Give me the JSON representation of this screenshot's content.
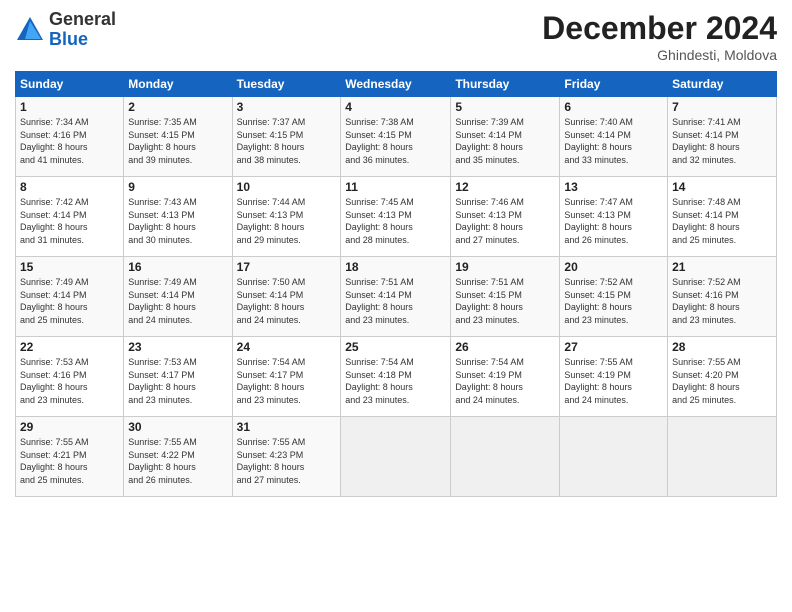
{
  "logo": {
    "general": "General",
    "blue": "Blue"
  },
  "title": "December 2024",
  "subtitle": "Ghindesti, Moldova",
  "days_of_week": [
    "Sunday",
    "Monday",
    "Tuesday",
    "Wednesday",
    "Thursday",
    "Friday",
    "Saturday"
  ],
  "weeks": [
    [
      {
        "day": "1",
        "info": "Sunrise: 7:34 AM\nSunset: 4:16 PM\nDaylight: 8 hours\nand 41 minutes."
      },
      {
        "day": "2",
        "info": "Sunrise: 7:35 AM\nSunset: 4:15 PM\nDaylight: 8 hours\nand 39 minutes."
      },
      {
        "day": "3",
        "info": "Sunrise: 7:37 AM\nSunset: 4:15 PM\nDaylight: 8 hours\nand 38 minutes."
      },
      {
        "day": "4",
        "info": "Sunrise: 7:38 AM\nSunset: 4:15 PM\nDaylight: 8 hours\nand 36 minutes."
      },
      {
        "day": "5",
        "info": "Sunrise: 7:39 AM\nSunset: 4:14 PM\nDaylight: 8 hours\nand 35 minutes."
      },
      {
        "day": "6",
        "info": "Sunrise: 7:40 AM\nSunset: 4:14 PM\nDaylight: 8 hours\nand 33 minutes."
      },
      {
        "day": "7",
        "info": "Sunrise: 7:41 AM\nSunset: 4:14 PM\nDaylight: 8 hours\nand 32 minutes."
      }
    ],
    [
      {
        "day": "8",
        "info": "Sunrise: 7:42 AM\nSunset: 4:14 PM\nDaylight: 8 hours\nand 31 minutes."
      },
      {
        "day": "9",
        "info": "Sunrise: 7:43 AM\nSunset: 4:13 PM\nDaylight: 8 hours\nand 30 minutes."
      },
      {
        "day": "10",
        "info": "Sunrise: 7:44 AM\nSunset: 4:13 PM\nDaylight: 8 hours\nand 29 minutes."
      },
      {
        "day": "11",
        "info": "Sunrise: 7:45 AM\nSunset: 4:13 PM\nDaylight: 8 hours\nand 28 minutes."
      },
      {
        "day": "12",
        "info": "Sunrise: 7:46 AM\nSunset: 4:13 PM\nDaylight: 8 hours\nand 27 minutes."
      },
      {
        "day": "13",
        "info": "Sunrise: 7:47 AM\nSunset: 4:13 PM\nDaylight: 8 hours\nand 26 minutes."
      },
      {
        "day": "14",
        "info": "Sunrise: 7:48 AM\nSunset: 4:14 PM\nDaylight: 8 hours\nand 25 minutes."
      }
    ],
    [
      {
        "day": "15",
        "info": "Sunrise: 7:49 AM\nSunset: 4:14 PM\nDaylight: 8 hours\nand 25 minutes."
      },
      {
        "day": "16",
        "info": "Sunrise: 7:49 AM\nSunset: 4:14 PM\nDaylight: 8 hours\nand 24 minutes."
      },
      {
        "day": "17",
        "info": "Sunrise: 7:50 AM\nSunset: 4:14 PM\nDaylight: 8 hours\nand 24 minutes."
      },
      {
        "day": "18",
        "info": "Sunrise: 7:51 AM\nSunset: 4:14 PM\nDaylight: 8 hours\nand 23 minutes."
      },
      {
        "day": "19",
        "info": "Sunrise: 7:51 AM\nSunset: 4:15 PM\nDaylight: 8 hours\nand 23 minutes."
      },
      {
        "day": "20",
        "info": "Sunrise: 7:52 AM\nSunset: 4:15 PM\nDaylight: 8 hours\nand 23 minutes."
      },
      {
        "day": "21",
        "info": "Sunrise: 7:52 AM\nSunset: 4:16 PM\nDaylight: 8 hours\nand 23 minutes."
      }
    ],
    [
      {
        "day": "22",
        "info": "Sunrise: 7:53 AM\nSunset: 4:16 PM\nDaylight: 8 hours\nand 23 minutes."
      },
      {
        "day": "23",
        "info": "Sunrise: 7:53 AM\nSunset: 4:17 PM\nDaylight: 8 hours\nand 23 minutes."
      },
      {
        "day": "24",
        "info": "Sunrise: 7:54 AM\nSunset: 4:17 PM\nDaylight: 8 hours\nand 23 minutes."
      },
      {
        "day": "25",
        "info": "Sunrise: 7:54 AM\nSunset: 4:18 PM\nDaylight: 8 hours\nand 23 minutes."
      },
      {
        "day": "26",
        "info": "Sunrise: 7:54 AM\nSunset: 4:19 PM\nDaylight: 8 hours\nand 24 minutes."
      },
      {
        "day": "27",
        "info": "Sunrise: 7:55 AM\nSunset: 4:19 PM\nDaylight: 8 hours\nand 24 minutes."
      },
      {
        "day": "28",
        "info": "Sunrise: 7:55 AM\nSunset: 4:20 PM\nDaylight: 8 hours\nand 25 minutes."
      }
    ],
    [
      {
        "day": "29",
        "info": "Sunrise: 7:55 AM\nSunset: 4:21 PM\nDaylight: 8 hours\nand 25 minutes."
      },
      {
        "day": "30",
        "info": "Sunrise: 7:55 AM\nSunset: 4:22 PM\nDaylight: 8 hours\nand 26 minutes."
      },
      {
        "day": "31",
        "info": "Sunrise: 7:55 AM\nSunset: 4:23 PM\nDaylight: 8 hours\nand 27 minutes."
      },
      {
        "day": "",
        "info": ""
      },
      {
        "day": "",
        "info": ""
      },
      {
        "day": "",
        "info": ""
      },
      {
        "day": "",
        "info": ""
      }
    ]
  ]
}
